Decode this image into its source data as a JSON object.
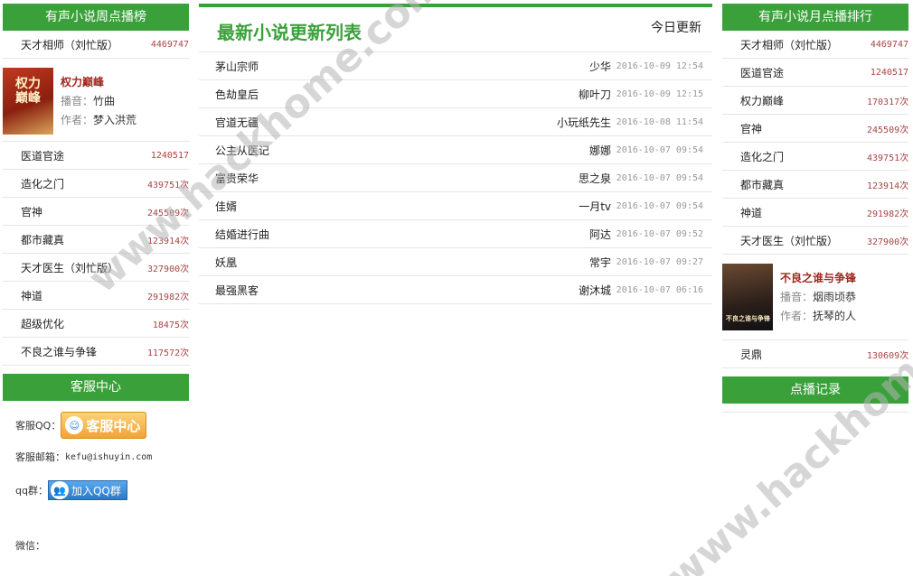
{
  "left": {
    "weekly_header": "有声小说周点播榜",
    "top_item": {
      "name": "天才相师（刘忙版）",
      "count": "4469747"
    },
    "feature": {
      "cover_text": "权力巅峰",
      "title": "权力巅峰",
      "narrator_label": "播音：",
      "narrator": "竹曲",
      "author_label": "作者：",
      "author": "梦入洪荒"
    },
    "items": [
      {
        "name": "医道官途",
        "count": "1240517"
      },
      {
        "name": "造化之门",
        "count": "439751次"
      },
      {
        "name": "官神",
        "count": "245509次"
      },
      {
        "name": "都市藏真",
        "count": "123914次"
      },
      {
        "name": "天才医生（刘忙版）",
        "count": "327900次"
      },
      {
        "name": "神道",
        "count": "291982次"
      },
      {
        "name": "超级优化",
        "count": "18475次"
      },
      {
        "name": "不良之谁与争锋",
        "count": "117572次"
      }
    ],
    "service_header": "客服中心",
    "service": {
      "qq_label": "客服QQ：",
      "qq_button": "客服中心",
      "email_label": "客服邮箱：",
      "email": "kefu@ishuyin.com",
      "group_label": "qq群：",
      "group_button": "加入QQ群",
      "wechat_label": "微信："
    }
  },
  "middle": {
    "title": "最新小说更新列表",
    "today": "今日更新",
    "rows": [
      {
        "title": "茅山宗师",
        "author": "少华",
        "date": "2016-10-09 12:54"
      },
      {
        "title": "色劫皇后",
        "author": "柳叶刀",
        "date": "2016-10-09 12:15"
      },
      {
        "title": "官道无疆",
        "author": "小玩纸先生",
        "date": "2016-10-08 11:54"
      },
      {
        "title": "公主从医记",
        "author": "娜娜",
        "date": "2016-10-07 09:54"
      },
      {
        "title": "富贵荣华",
        "author": "思之泉",
        "date": "2016-10-07 09:54"
      },
      {
        "title": "佳婿",
        "author": "一月tv",
        "date": "2016-10-07 09:54"
      },
      {
        "title": "结婚进行曲",
        "author": "阿达",
        "date": "2016-10-07 09:52"
      },
      {
        "title": "妖凰",
        "author": "常宇",
        "date": "2016-10-07 09:27"
      },
      {
        "title": "最强黑客",
        "author": "谢沐城",
        "date": "2016-10-07 06:16"
      }
    ]
  },
  "right": {
    "monthly_header": "有声小说月点播排行",
    "items": [
      {
        "name": "天才相师（刘忙版）",
        "count": "4469747"
      },
      {
        "name": "医道官途",
        "count": "1240517"
      },
      {
        "name": "权力巅峰",
        "count": "170317次"
      },
      {
        "name": "官神",
        "count": "245509次"
      },
      {
        "name": "造化之门",
        "count": "439751次"
      },
      {
        "name": "都市藏真",
        "count": "123914次"
      },
      {
        "name": "神道",
        "count": "291982次"
      },
      {
        "name": "天才医生（刘忙版）",
        "count": "327900次"
      }
    ],
    "feature": {
      "cover_text": "不良之谁与争锋",
      "title": "不良之谁与争锋",
      "narrator_label": "播音：",
      "narrator": "烟雨顷恭",
      "author_label": "作者：",
      "author": "抚琴的人"
    },
    "last_item": {
      "name": "灵鼎",
      "count": "130609次"
    },
    "history_header": "点播记录"
  },
  "watermark": "www.hackhome.com"
}
